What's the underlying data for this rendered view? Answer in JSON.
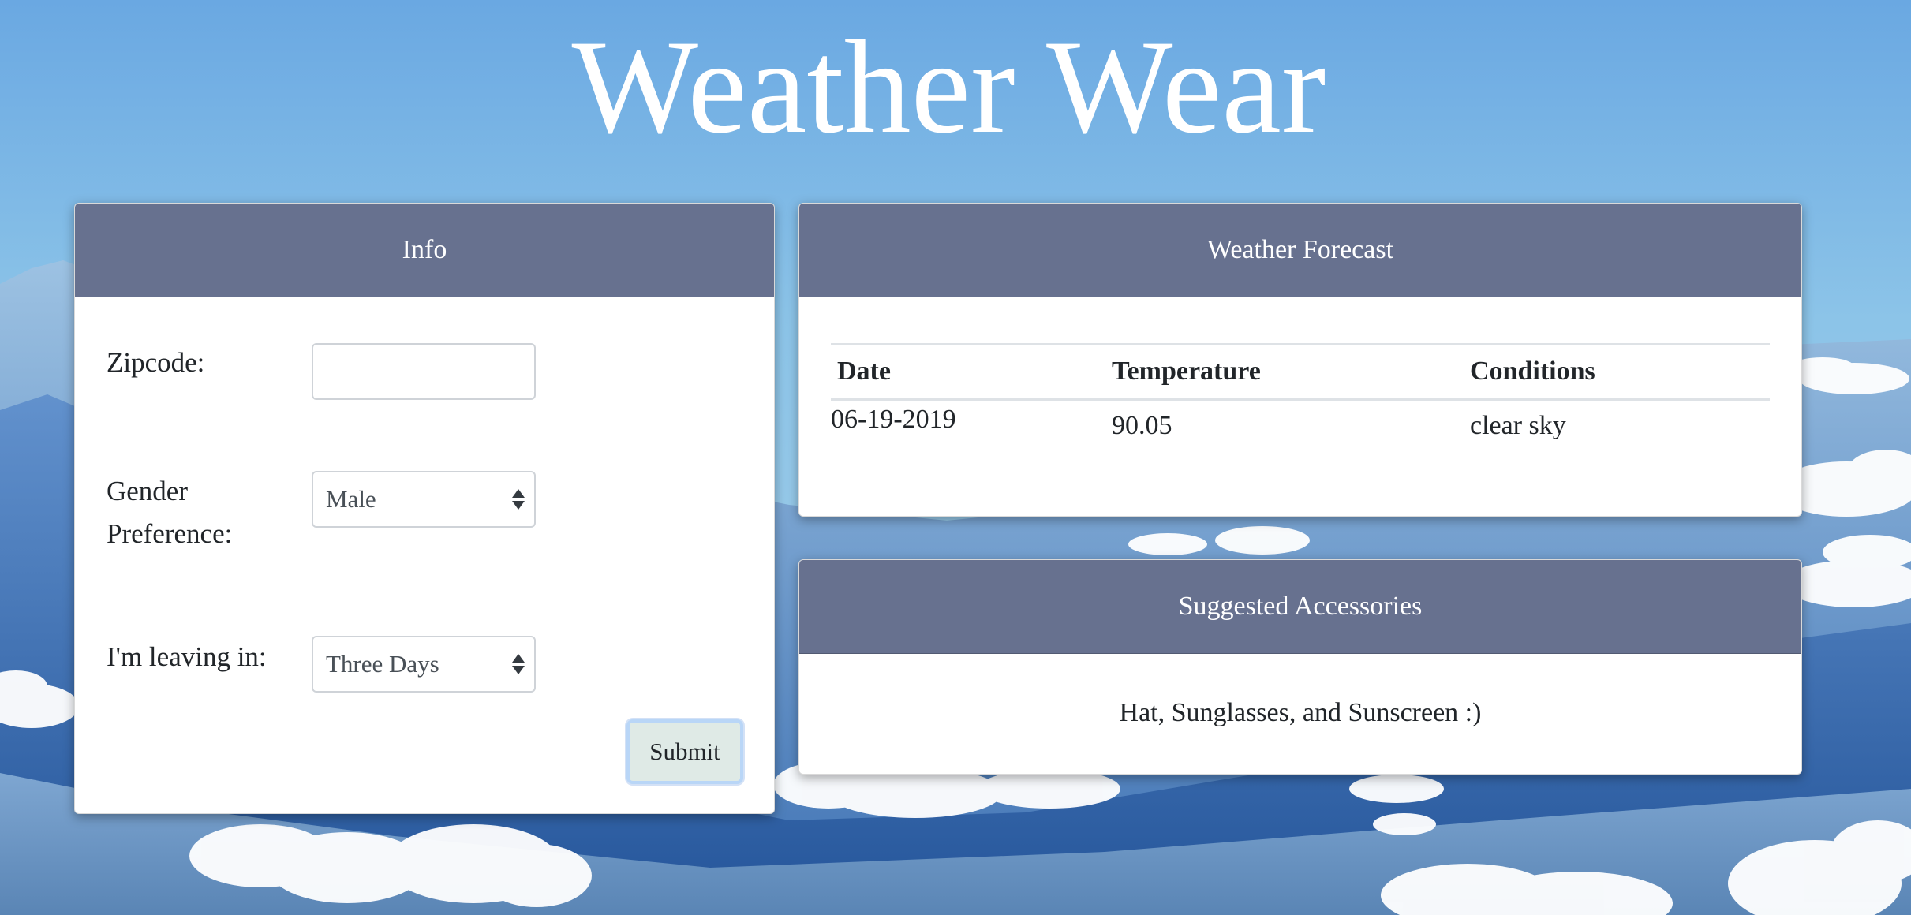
{
  "app": {
    "title": "Weather Wear"
  },
  "info": {
    "header": "Info",
    "zipcode_label": "Zipcode:",
    "zipcode_value": "",
    "gender_label_line1": "Gender",
    "gender_label_line2": "Preference:",
    "gender_selected": "Male",
    "leaving_label": "I'm leaving in:",
    "leaving_selected": "Three Days",
    "submit_label": "Submit"
  },
  "forecast": {
    "header": "Weather Forecast",
    "columns": [
      "Date",
      "Temperature",
      "Conditions"
    ],
    "rows": [
      [
        "06-19-2019",
        "90.05",
        "clear sky"
      ]
    ]
  },
  "accessories": {
    "header": "Suggested Accessories",
    "text": "Hat, Sunglasses, and Sunscreen :)"
  },
  "colors": {
    "card_header": "#67718f",
    "sky": "#7fb7e4",
    "submit_bg": "#dfeae6"
  }
}
